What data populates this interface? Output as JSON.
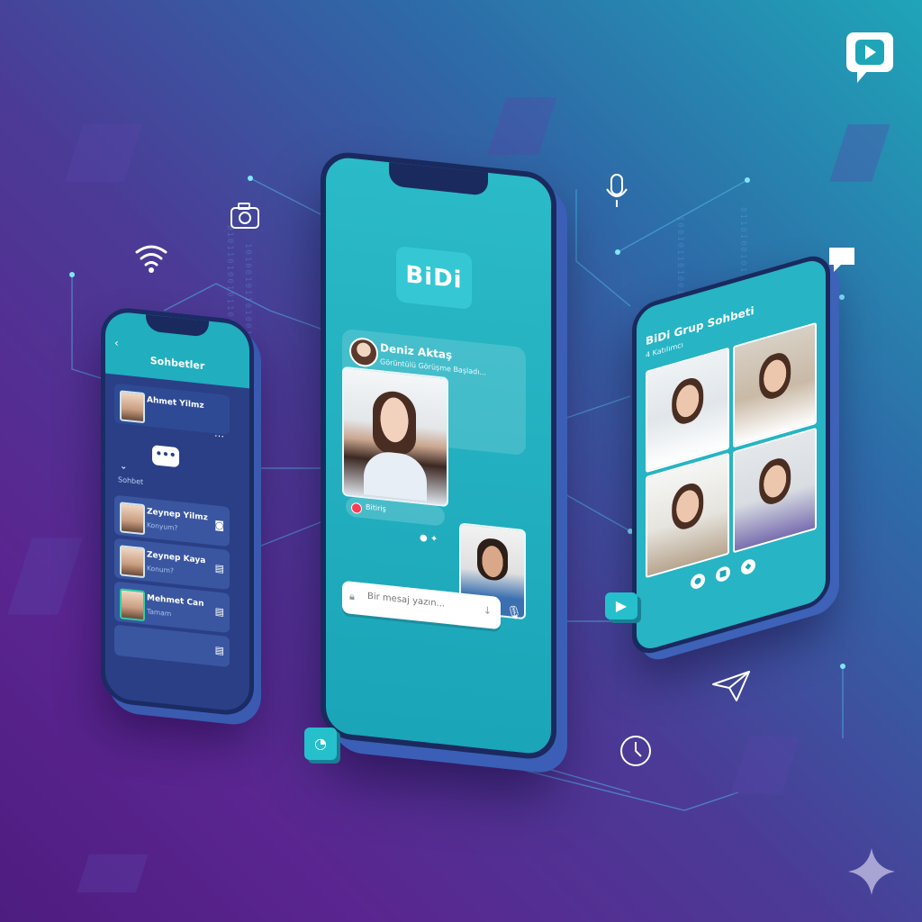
{
  "left_phone": {
    "header_title": "Sohbetler",
    "back_glyph": "‹",
    "pinned": {
      "name": "Ahmet Yilmz",
      "action_glyph": "⋯"
    },
    "section_label": "Sohbet",
    "contacts": [
      {
        "name": "Zeynep Yilmz",
        "sub": "Konyum?",
        "icon": "camera-icon",
        "glyph": "◙"
      },
      {
        "name": "Zeynep Kaya",
        "sub": "Konum?",
        "icon": "list-icon",
        "glyph": "▤"
      },
      {
        "name": "Mehmet Can",
        "sub": "Tamam",
        "icon": "list-icon",
        "glyph": "▤"
      },
      {
        "name": "",
        "sub": "",
        "icon": "list-icon",
        "glyph": "▤"
      }
    ]
  },
  "center_phone": {
    "app_logo": "BiDi",
    "contact_name": "Deniz Aktaş",
    "contact_status": "Görüntülü Görüşme Başladı...",
    "recording_label": "Bitiriş",
    "message_placeholder": "Bir mesaj yazın...",
    "icons": {
      "lock": "lock-icon",
      "mic": "microphone-icon"
    }
  },
  "right_phone": {
    "title": "BiDi Grup Sohbeti",
    "subtitle": "4 Katılımcı",
    "participants": 4
  },
  "decor": {
    "top_right_logo": "play-chat-icon",
    "floating_icons": [
      "camera-icon",
      "wifi-icon",
      "microphone-icon",
      "chat-icon",
      "play-icon",
      "send-icon",
      "clock-icon",
      "sparkle-icon"
    ]
  },
  "colors": {
    "teal": "#25c0cc",
    "navy": "#1a2a5e",
    "purple": "#5a2590"
  }
}
